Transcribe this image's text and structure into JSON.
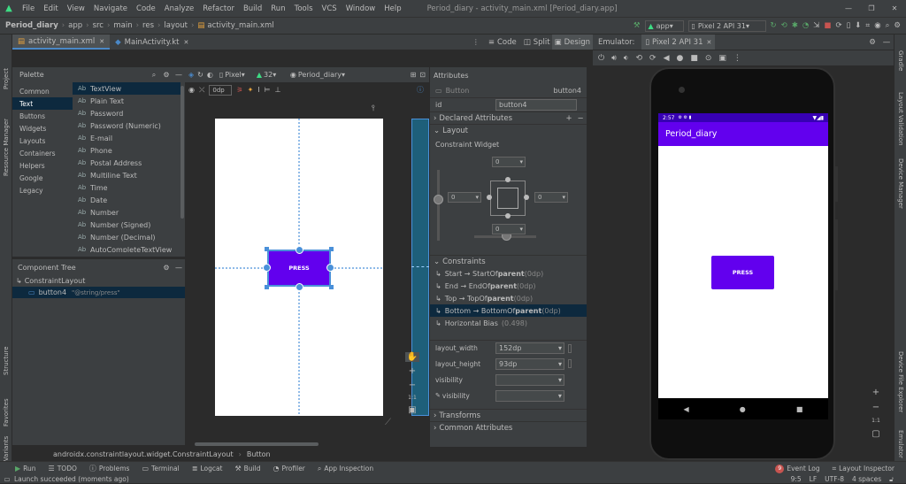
{
  "menu": [
    "File",
    "Edit",
    "View",
    "Navigate",
    "Code",
    "Analyze",
    "Refactor",
    "Build",
    "Run",
    "Tools",
    "VCS",
    "Window",
    "Help"
  ],
  "window_title": "Period_diary - activity_main.xml [Period_diary.app]",
  "breadcrumb": [
    "Period_diary",
    "app",
    "src",
    "main",
    "res",
    "layout",
    "activity_main.xml"
  ],
  "run_config": "app",
  "device": "Pixel 2 API 31",
  "tabs": [
    {
      "label": "activity_main.xml",
      "active": true
    },
    {
      "label": "MainActivity.kt",
      "active": false
    }
  ],
  "view_modes": {
    "code": "Code",
    "split": "Split",
    "design": "Design"
  },
  "emulator": {
    "label": "Emulator:",
    "tab": "Pixel 2 API 31"
  },
  "palette": {
    "title": "Palette",
    "categories": [
      "Common",
      "Text",
      "Buttons",
      "Widgets",
      "Layouts",
      "Containers",
      "Helpers",
      "Google",
      "Legacy"
    ],
    "selected_category": "Text",
    "items": [
      "TextView",
      "Plain Text",
      "Password",
      "Password (Numeric)",
      "E-mail",
      "Phone",
      "Postal Address",
      "Multiline Text",
      "Time",
      "Date",
      "Number",
      "Number (Signed)",
      "Number (Decimal)",
      "AutoCompleteTextView"
    ],
    "item_glyph": "Ab"
  },
  "design_toolbar": {
    "margin": "0dp",
    "device": "Pixel",
    "api": "32",
    "theme": "Period_diary"
  },
  "component_tree": {
    "title": "Component Tree",
    "root": "ConstraintLayout",
    "child": "button4",
    "child_text": "\"@string/press\""
  },
  "canvas": {
    "button_text": "PRESS"
  },
  "attributes": {
    "title": "Attributes",
    "widget": "Button",
    "widget_id": "button4",
    "id_label": "id",
    "id_value": "button4",
    "declared": "Declared Attributes",
    "layout": "Layout",
    "constraint_widget": "Constraint Widget",
    "margins": {
      "top": "0",
      "left": "0",
      "right": "0",
      "bottom": "0"
    },
    "constraints_title": "Constraints",
    "constraints": [
      {
        "text": "Start → StartOf ",
        "bold": "parent",
        "dp": " (0dp)"
      },
      {
        "text": "End → EndOf ",
        "bold": "parent",
        "dp": " (0dp)"
      },
      {
        "text": "Top → TopOf ",
        "bold": "parent",
        "dp": " (0dp)"
      },
      {
        "text": "Bottom → BottomOf ",
        "bold": "parent",
        "dp": " (0dp)"
      }
    ],
    "bias_label": "Horizontal Bias",
    "bias_value": "(0.498)",
    "layout_width_label": "layout_width",
    "layout_width": "152dp",
    "layout_height_label": "layout_height",
    "layout_height": "93dp",
    "visibility_label": "visibility",
    "visibility2_label": "visibility",
    "transforms": "Transforms",
    "common": "Common Attributes"
  },
  "phone": {
    "time": "2:57",
    "app_title": "Period_diary",
    "button_text": "PRESS"
  },
  "bottom_breadcrumb": [
    "androidx.constraintlayout.widget.ConstraintLayout",
    "Button"
  ],
  "tool_windows": [
    "Run",
    "TODO",
    "Problems",
    "Terminal",
    "Logcat",
    "Build",
    "Profiler",
    "App Inspection"
  ],
  "tool_windows_right": [
    "Event Log",
    "Layout Inspector"
  ],
  "event_count": "9",
  "status": {
    "message": "Launch succeeded (moments ago)",
    "pos": "9:5",
    "lf": "LF",
    "enc": "UTF-8",
    "indent": "4 spaces"
  },
  "left_strip": [
    "Project",
    "Resource Manager",
    "Structure",
    "Favorites",
    "Build Variants"
  ],
  "right_strip": [
    "Gradle",
    "Layout Validation",
    "Device Manager",
    "Device File Explorer",
    "Emulator"
  ],
  "colors": {
    "accent": "#6200ee",
    "selected": "#0d293e",
    "blueprint": "#4a90d9",
    "run_green": "#59a869"
  }
}
